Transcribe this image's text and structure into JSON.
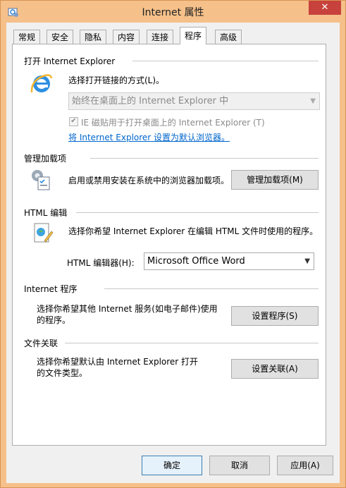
{
  "window": {
    "title": "Internet 属性",
    "close_label": "✕"
  },
  "tabs": [
    {
      "label": "常规"
    },
    {
      "label": "安全"
    },
    {
      "label": "隐私"
    },
    {
      "label": "内容"
    },
    {
      "label": "连接"
    },
    {
      "label": "程序"
    },
    {
      "label": "高级"
    }
  ],
  "active_tab": "程序",
  "open_ie": {
    "title": "打开 Internet Explorer",
    "choose_label": "选择打开链接的方式(L)。",
    "select_value": "始终在桌面上的 Internet Explorer 中",
    "tile_checkbox_label": "IE 磁贴用于打开桌面上的 Internet Explorer (T)",
    "tile_checked": true,
    "default_link": "将 Internet Explorer 设置为默认浏览器。"
  },
  "addons": {
    "title": "管理加载项",
    "description": "启用或禁用安装在系统中的浏览器加载项。",
    "button": "管理加载项(M)"
  },
  "html_edit": {
    "title": "HTML 编辑",
    "description": "选择你希望 Internet Explorer 在编辑 HTML 文件时使用的程序。",
    "editor_label": "HTML 编辑器(H):",
    "editor_value": "Microsoft Office Word"
  },
  "programs": {
    "title": "Internet 程序",
    "description_line1": "选择你希望其他 Internet 服务(如电子邮件)使用",
    "description_line2": "的程序。",
    "button": "设置程序(S)"
  },
  "assoc": {
    "title": "文件关联",
    "description_line1": "选择你希望默认由 Internet Explorer 打开",
    "description_line2": "的文件类型。",
    "button": "设置关联(A)"
  },
  "footer": {
    "ok": "确定",
    "cancel": "取消",
    "apply": "应用(A)"
  },
  "colors": {
    "frame": "#f5c08a",
    "close": "#c7423c",
    "link": "#0066cc"
  }
}
